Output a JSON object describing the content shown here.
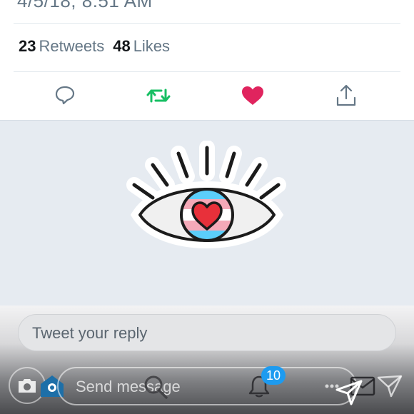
{
  "tweet": {
    "timestamp": "4/5/18, 8:51 AM",
    "stats": {
      "retweets_count": "23",
      "retweets_label": "Retweets",
      "likes_count": "48",
      "likes_label": "Likes"
    },
    "actions": [
      {
        "icon": "reply-icon",
        "color": "#657786"
      },
      {
        "icon": "retweet-icon",
        "color": "#17bf63",
        "active": true
      },
      {
        "icon": "heart-icon",
        "color": "#e0245e",
        "active": true
      },
      {
        "icon": "share-icon",
        "color": "#657786"
      }
    ],
    "media": {
      "icon": "eye-heart-sticker",
      "flag_colors": [
        "#5bcefa",
        "#f5a9b8",
        "#ffffff"
      ],
      "heart_color": "#e8303a"
    }
  },
  "reply": {
    "placeholder": "Tweet your reply"
  },
  "story_overlay": {
    "message_placeholder": "Send message",
    "notification_count": "10",
    "accent": "#1d9bf0"
  }
}
